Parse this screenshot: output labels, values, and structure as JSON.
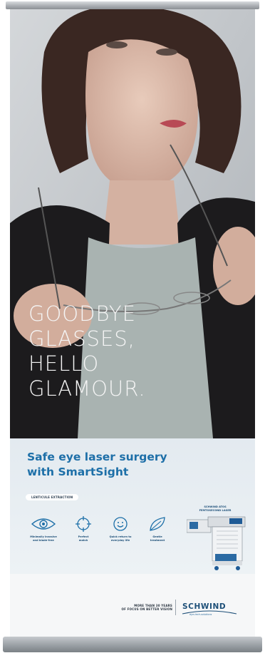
{
  "poster": {
    "headline": [
      "GOODBYE",
      "GLASSES,",
      "HELLO",
      "GLAMOUR."
    ],
    "subhead": [
      "Safe eye laser surgery",
      "with SmartSight"
    ],
    "tag": "LENTICULE EXTRACTION",
    "features": [
      {
        "icon": "eye-icon",
        "label": [
          "Minimally invasive",
          "and blade-free"
        ]
      },
      {
        "icon": "crosshair-icon",
        "label": [
          "Perfect",
          "match"
        ]
      },
      {
        "icon": "smiley-icon",
        "label": [
          "Quick return to",
          "everyday life"
        ]
      },
      {
        "icon": "leaf-icon",
        "label": [
          "Gentle",
          "treatment"
        ]
      }
    ],
    "device_label": [
      "SCHWIND ATOS",
      "FEMTOSECOND LASER"
    ],
    "claim": [
      "MORE THAN 30 YEARS",
      "OF FOCUS ON BETTER VISION"
    ],
    "brand": {
      "name": "SCHWIND",
      "tagline": "eye-tech-solutions"
    }
  },
  "colors": {
    "accent": "#1d6fa8",
    "brand": "#1d4f78",
    "headline": "#f4f4f4"
  }
}
